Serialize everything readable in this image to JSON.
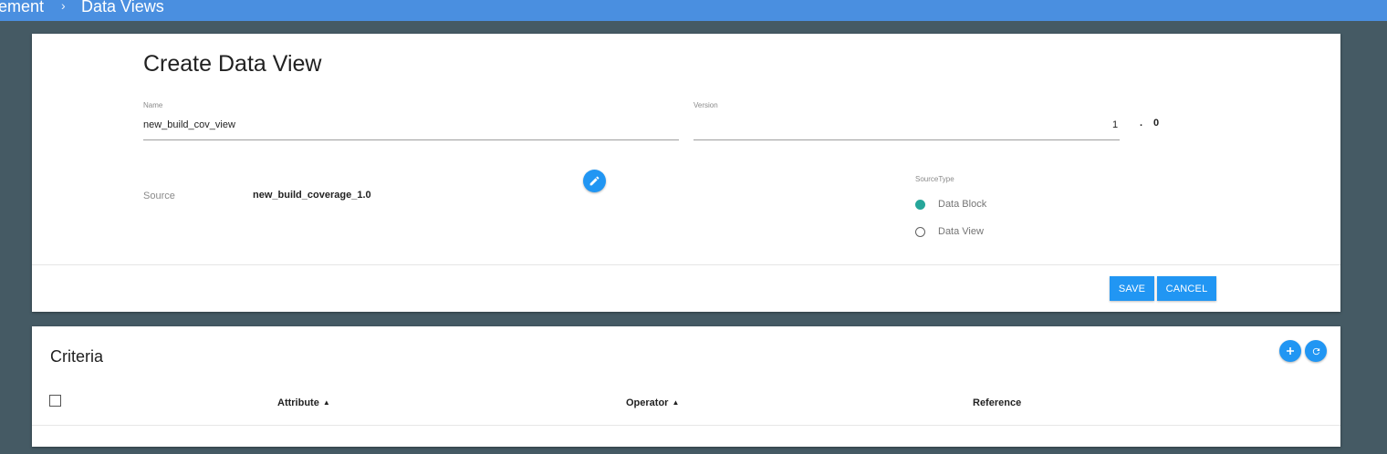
{
  "breadcrumb": {
    "parent": "ement",
    "separator": "›",
    "current": "Data Views"
  },
  "form": {
    "title": "Create Data View",
    "name_label": "Name",
    "name_value": "new_build_cov_view",
    "version_label": "Version",
    "version_major": "1",
    "version_dot": ".",
    "version_minor": "0",
    "source_label": "Source",
    "source_value": "new_build_coverage_1.0",
    "edit_icon": "pencil-icon",
    "source_type_label": "SourceType",
    "source_type_options": [
      "Data Block",
      "Data View"
    ],
    "source_type_selected": "Data Block",
    "save_label": "SAVE",
    "cancel_label": "CANCEL"
  },
  "criteria": {
    "title": "Criteria",
    "add_icon": "plus-icon",
    "refresh_icon": "refresh-icon",
    "columns": [
      "Attribute",
      "Operator",
      "Reference"
    ],
    "sort_glyph": "▲"
  },
  "colors": {
    "header": "#4a8fe0",
    "background": "#455a64",
    "accent": "#2196f3",
    "radio_on": "#26a69a"
  }
}
